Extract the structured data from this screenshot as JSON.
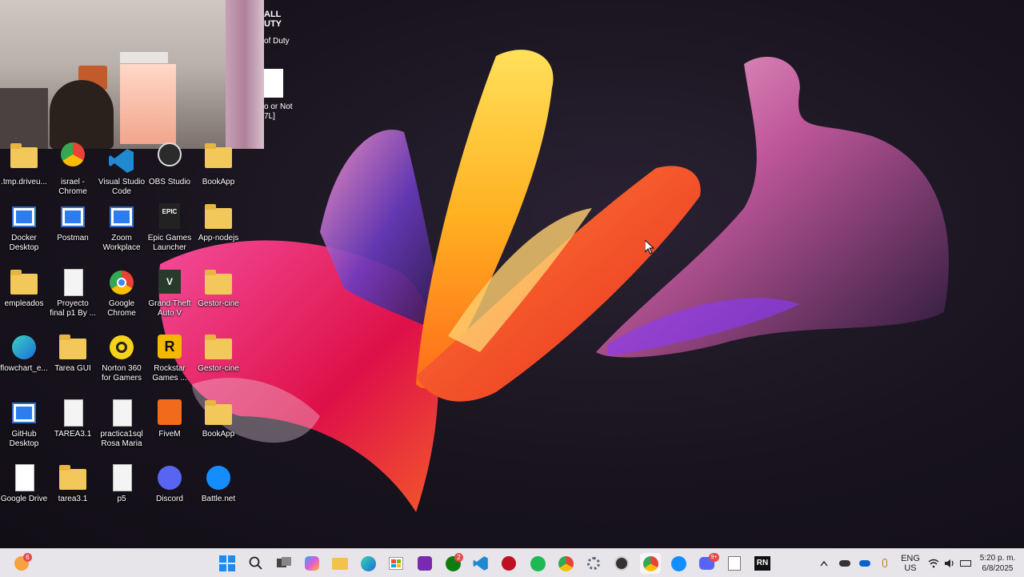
{
  "webcam": {
    "label": "webcam-overlay"
  },
  "game_tile": {
    "line1": "ALL",
    "line2": "UTY",
    "line3": "of Duty",
    "line4": "o or Not",
    "line5": "7L]"
  },
  "desktop_icons": [
    {
      "label": ".tmp.driveu..."
    },
    {
      "label": "israel - Chrome"
    },
    {
      "label": "Visual Studio Code"
    },
    {
      "label": "OBS Studio"
    },
    {
      "label": "BookApp"
    },
    {
      "label": "Docker Desktop"
    },
    {
      "label": "Postman"
    },
    {
      "label": "Zoom Workplace"
    },
    {
      "label": "Epic Games Launcher"
    },
    {
      "label": "App-nodejs"
    },
    {
      "label": "empleados"
    },
    {
      "label": "Proyecto final p1 By ..."
    },
    {
      "label": "Google Chrome"
    },
    {
      "label": "Grand Theft Auto V"
    },
    {
      "label": "Gestor-cine"
    },
    {
      "label": "flowchart_e..."
    },
    {
      "label": "Tarea GUI"
    },
    {
      "label": "Norton 360 for Gamers"
    },
    {
      "label": "Rockstar Games ..."
    },
    {
      "label": "Gestor-cine"
    },
    {
      "label": "GitHub Desktop"
    },
    {
      "label": "TAREA3.1"
    },
    {
      "label": "practica1sql Rosa Maria"
    },
    {
      "label": "FiveM"
    },
    {
      "label": "BookApp"
    },
    {
      "label": "Google Drive"
    },
    {
      "label": "tarea3.1"
    },
    {
      "label": "p5"
    },
    {
      "label": "Discord"
    },
    {
      "label": "Battle.net"
    }
  ],
  "taskbar": {
    "weather_badge": "6",
    "xbox_badge": "2",
    "discord_badge": "9+",
    "lang_top": "ENG",
    "lang_bottom": "US",
    "time": "5:20 p. m.",
    "date": "6/8/2025"
  },
  "colors": {
    "taskbar_bg": "#e7e4ea",
    "desktop_bg": "#18131d",
    "folder": "#f3c85a"
  }
}
